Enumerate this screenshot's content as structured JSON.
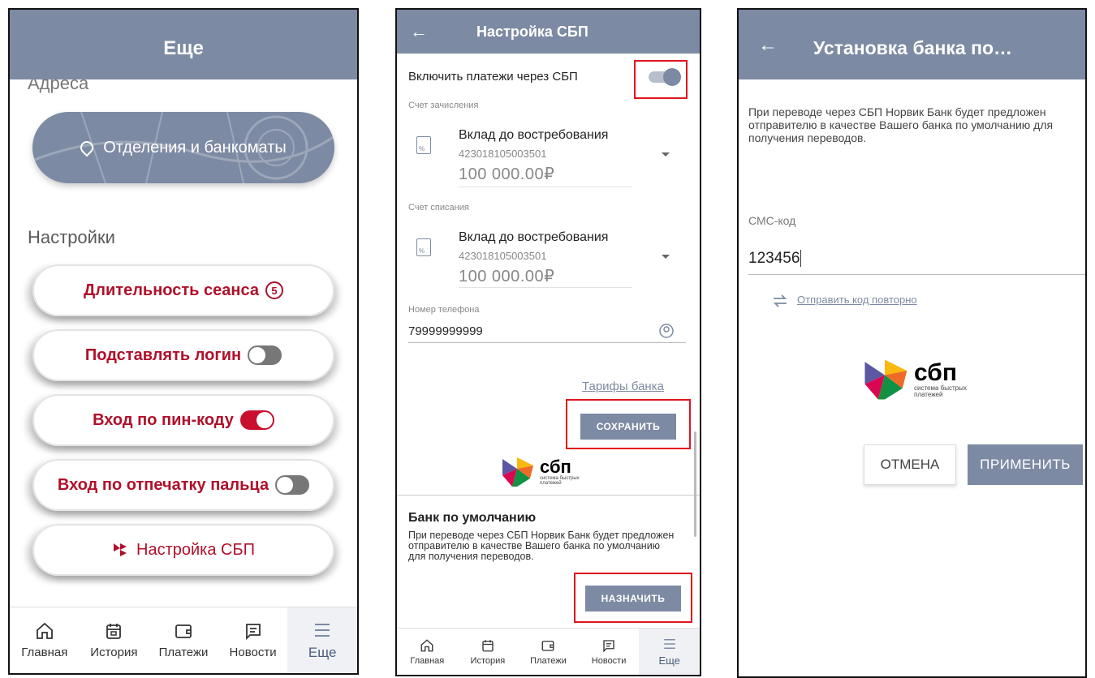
{
  "screen1": {
    "title": "Еще",
    "partial_section": "Адреса",
    "branches_button": "Отделения и банкоматы",
    "settings_head": "Настройки",
    "session_label": "Длительность сеанса",
    "session_badge": "5",
    "login_label": "Подставлять логин",
    "login_toggle": false,
    "pin_label": "Вход по пин-коду",
    "pin_toggle": true,
    "finger_label": "Вход по отпечатку пальца",
    "finger_toggle": false,
    "sbp_label": "Настройка СБП",
    "nav": [
      "Главная",
      "История",
      "Платежи",
      "Новости",
      "Еще"
    ],
    "nav_active": "Еще"
  },
  "screen2": {
    "title": "Настройка СБП",
    "enable_label": "Включить платежи через СБП",
    "enable_toggle": true,
    "credit_caption": "Счет зачисления",
    "credit_name": "Вклад до востребования",
    "credit_number": "423018105003501",
    "credit_amount": "100 000.00₽",
    "debit_caption": "Счет списания",
    "debit_name": "Вклад до востребования",
    "debit_number": "423018105003501",
    "debit_amount": "100 000.00₽",
    "phone_caption": "Номер телефона",
    "phone_value": "79999999999",
    "tariffs_link": "Тарифы банка",
    "save_button": "СОХРАНИТЬ",
    "sbp_word": "сбп",
    "sbp_sub_1": "система быстрых",
    "sbp_sub_2": "платежей",
    "default_bank_title": "Банк по умолчанию",
    "default_bank_text": "При переводе через СБП Норвик Банк будет предложен отправителю в качестве Вашего банка по умолчанию для получения переводов.",
    "assign_button": "НАЗНАЧИТЬ",
    "nav": [
      "Главная",
      "История",
      "Платежи",
      "Новости",
      "Еще"
    ],
    "nav_active": "Еще"
  },
  "screen3": {
    "title": "Установка банка по…",
    "info_text": "При переводе через СБП Норвик Банк будет предложен отправителю в качестве Вашего банка по умолчанию для получения переводов.",
    "sms_label": "СМС-код",
    "sms_value": "123456",
    "resend_link": "Отправить код повторно",
    "sbp_word": "сбп",
    "sbp_sub_1": "система быстрых",
    "sbp_sub_2": "платежей",
    "cancel_button": "ОТМЕНА",
    "apply_button": "ПРИМЕНИТЬ"
  },
  "colors": {
    "header": "#7d8aa3",
    "brand_red": "#b0102a",
    "highlight_box": "#e0141e"
  }
}
